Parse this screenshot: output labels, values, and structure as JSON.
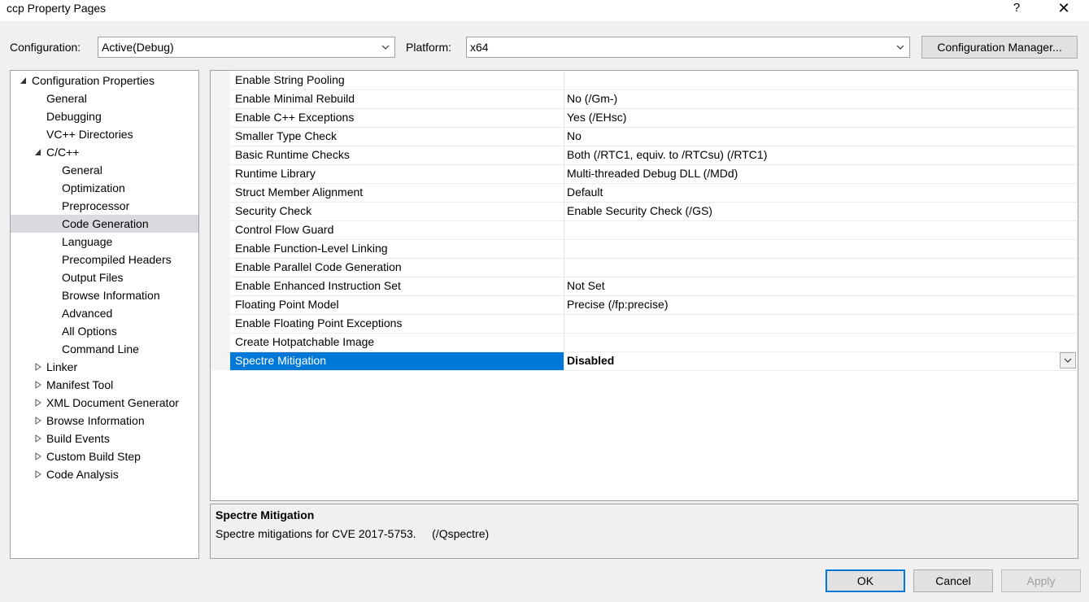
{
  "window": {
    "title": "ccp Property Pages",
    "help": "?",
    "close": "✕"
  },
  "config": {
    "configuration_label": "Configuration:",
    "configuration_value": "Active(Debug)",
    "platform_label": "Platform:",
    "platform_value": "x64",
    "manager_button": "Configuration Manager..."
  },
  "tree": [
    {
      "label": "Configuration Properties",
      "level": 0,
      "expander": "expanded"
    },
    {
      "label": "General",
      "level": 1
    },
    {
      "label": "Debugging",
      "level": 1
    },
    {
      "label": "VC++ Directories",
      "level": 1
    },
    {
      "label": "C/C++",
      "level": 1,
      "expander": "expanded"
    },
    {
      "label": "General",
      "level": 2
    },
    {
      "label": "Optimization",
      "level": 2
    },
    {
      "label": "Preprocessor",
      "level": 2
    },
    {
      "label": "Code Generation",
      "level": 2,
      "selected": true
    },
    {
      "label": "Language",
      "level": 2
    },
    {
      "label": "Precompiled Headers",
      "level": 2
    },
    {
      "label": "Output Files",
      "level": 2
    },
    {
      "label": "Browse Information",
      "level": 2
    },
    {
      "label": "Advanced",
      "level": 2
    },
    {
      "label": "All Options",
      "level": 2
    },
    {
      "label": "Command Line",
      "level": 2
    },
    {
      "label": "Linker",
      "level": 1,
      "expander": "collapsed"
    },
    {
      "label": "Manifest Tool",
      "level": 1,
      "expander": "collapsed"
    },
    {
      "label": "XML Document Generator",
      "level": 1,
      "expander": "collapsed"
    },
    {
      "label": "Browse Information",
      "level": 1,
      "expander": "collapsed"
    },
    {
      "label": "Build Events",
      "level": 1,
      "expander": "collapsed"
    },
    {
      "label": "Custom Build Step",
      "level": 1,
      "expander": "collapsed"
    },
    {
      "label": "Code Analysis",
      "level": 1,
      "expander": "collapsed"
    }
  ],
  "properties": [
    {
      "name": "Enable String Pooling",
      "value": ""
    },
    {
      "name": "Enable Minimal Rebuild",
      "value": "No (/Gm-)"
    },
    {
      "name": "Enable C++ Exceptions",
      "value": "Yes (/EHsc)"
    },
    {
      "name": "Smaller Type Check",
      "value": "No"
    },
    {
      "name": "Basic Runtime Checks",
      "value": "Both (/RTC1, equiv. to /RTCsu) (/RTC1)"
    },
    {
      "name": "Runtime Library",
      "value": "Multi-threaded Debug DLL (/MDd)"
    },
    {
      "name": "Struct Member Alignment",
      "value": "Default"
    },
    {
      "name": "Security Check",
      "value": "Enable Security Check (/GS)"
    },
    {
      "name": "Control Flow Guard",
      "value": ""
    },
    {
      "name": "Enable Function-Level Linking",
      "value": ""
    },
    {
      "name": "Enable Parallel Code Generation",
      "value": ""
    },
    {
      "name": "Enable Enhanced Instruction Set",
      "value": "Not Set"
    },
    {
      "name": "Floating Point Model",
      "value": "Precise (/fp:precise)"
    },
    {
      "name": "Enable Floating Point Exceptions",
      "value": ""
    },
    {
      "name": "Create Hotpatchable Image",
      "value": ""
    },
    {
      "name": "Spectre Mitigation",
      "value": "Disabled",
      "selected": true
    }
  ],
  "description": {
    "title": "Spectre Mitigation",
    "text": "Spectre mitigations for CVE 2017-5753.     (/Qspectre)"
  },
  "buttons": {
    "ok": "OK",
    "cancel": "Cancel",
    "apply": "Apply"
  },
  "colors": {
    "selection": "#0078d7",
    "tree_selection": "#d9d9e0",
    "window_bg": "#f0f0f0"
  }
}
